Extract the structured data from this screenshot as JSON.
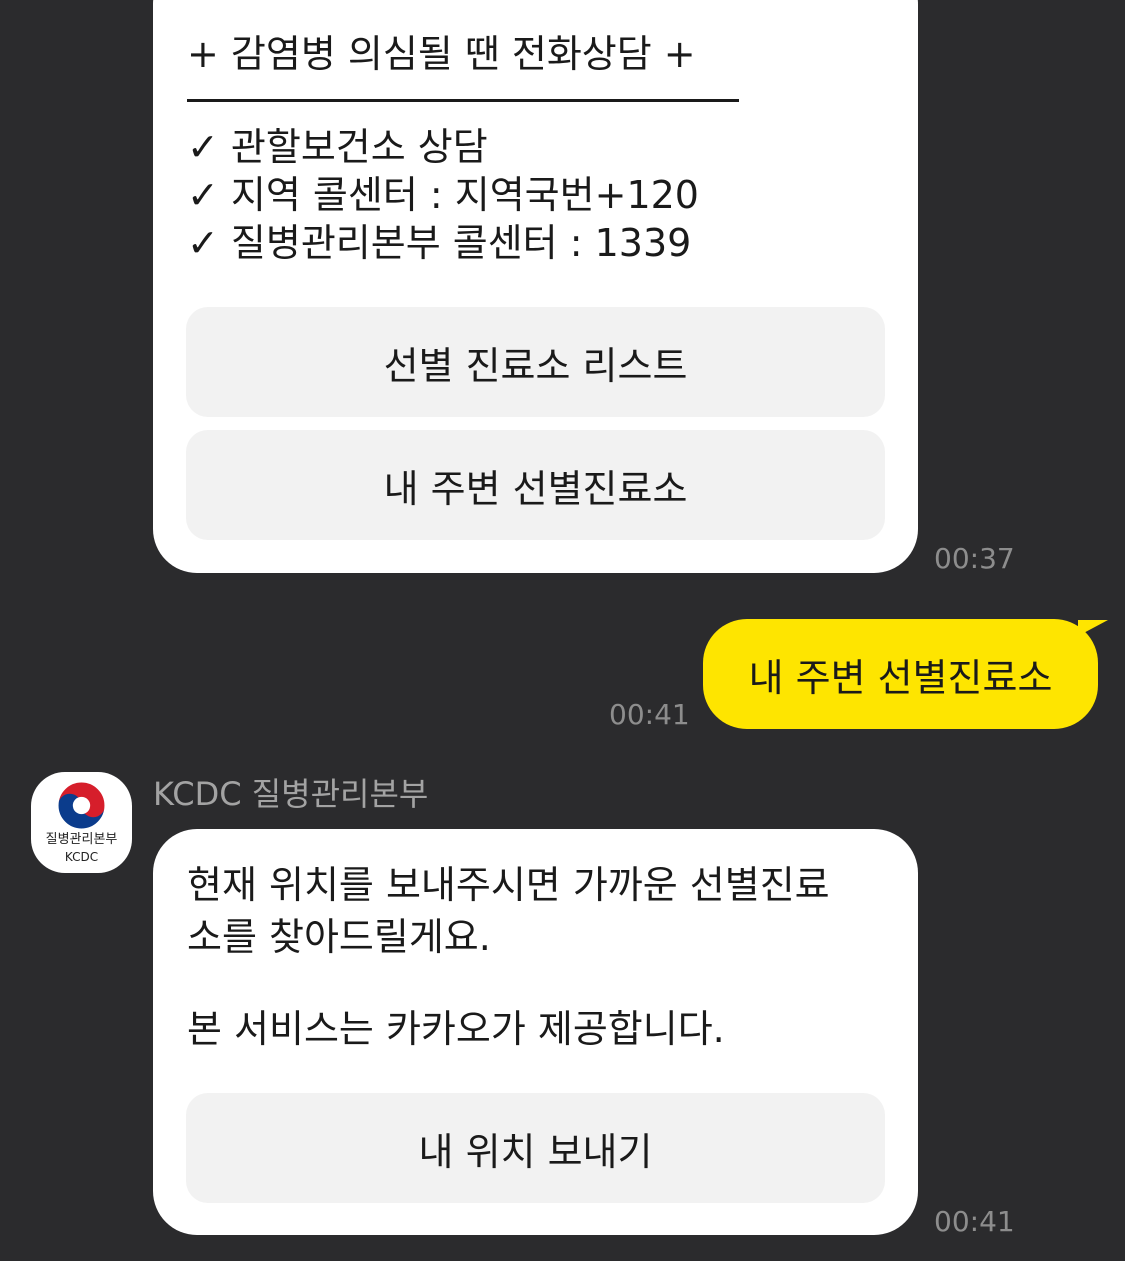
{
  "messages": {
    "first": {
      "heading": "+ 감염병 의심될 땐 전화상담 +",
      "lines": [
        "✓ 관할보건소 상담",
        "✓ 지역 콜센터 : 지역국번+120",
        "✓ 질병관리본부 콜센터 : 1339"
      ],
      "buttons": [
        "선별 진료소 리스트",
        "내 주변 선별진료소"
      ],
      "time": "00:37"
    },
    "outgoing": {
      "text": "내 주변 선별진료소",
      "time": "00:41"
    },
    "sender": {
      "name": "KCDC 질병관리본부",
      "avatar_line1": "질병관리본부",
      "avatar_line2": "KCDC"
    },
    "second": {
      "lines": [
        "현재 위치를 보내주시면 가까운 선별진료",
        "소를 찾아드릴게요.",
        "본 서비스는 카카오가 제공합니다."
      ],
      "button": "내 위치 보내기",
      "time": "00:41"
    }
  },
  "colors": {
    "background": "#2b2b2d",
    "incoming_bubble": "#ffffff",
    "outgoing_bubble": "#fee500",
    "button_bg": "#f2f2f2",
    "timestamp": "#8d8d8d"
  }
}
